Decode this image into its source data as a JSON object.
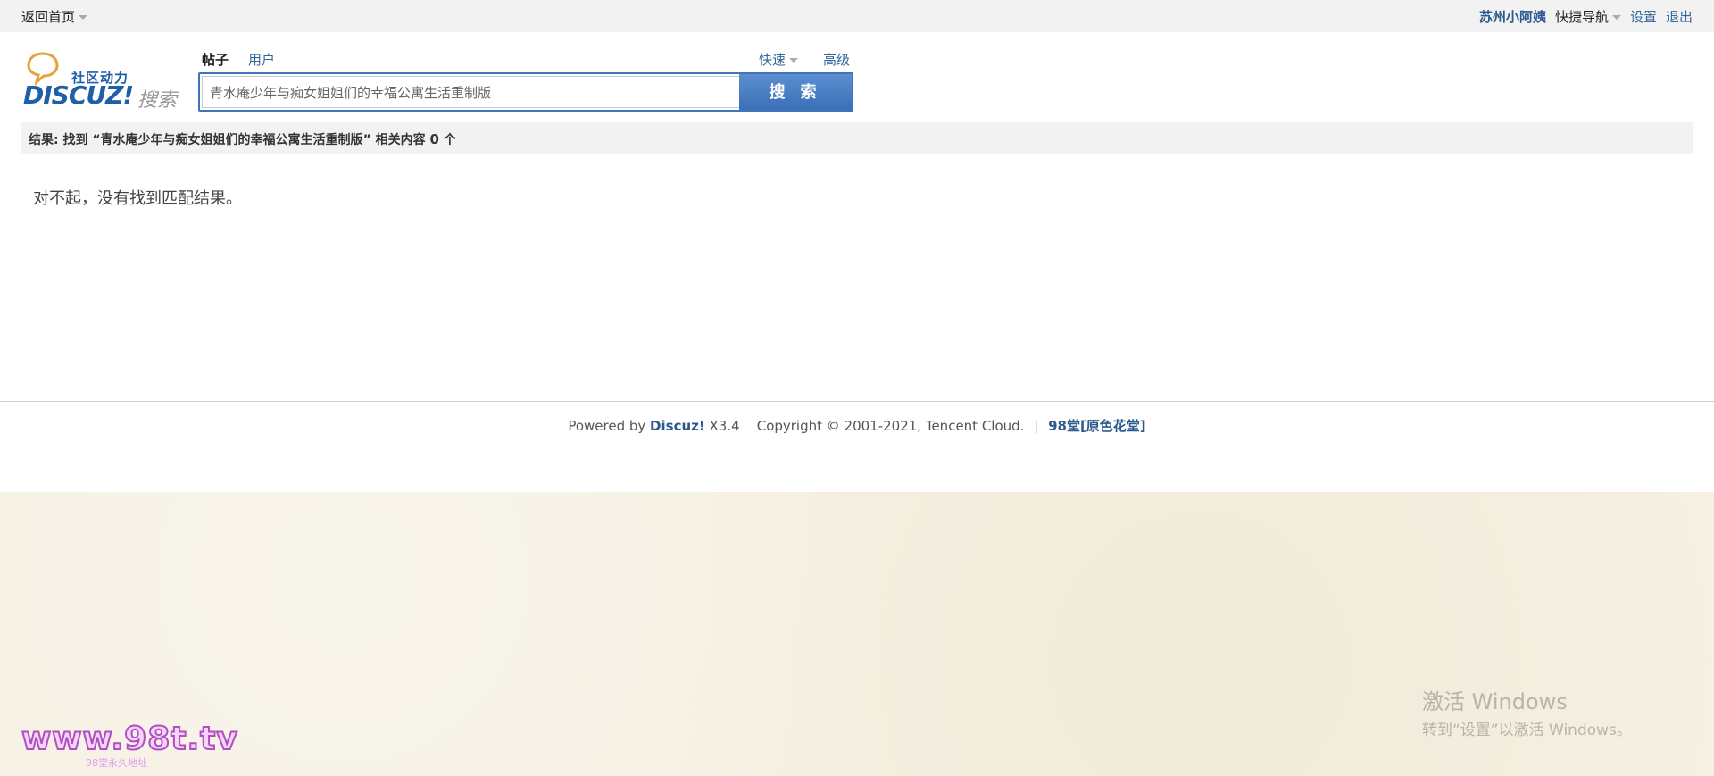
{
  "topbar": {
    "home": "返回首页",
    "user": "苏州小阿姨",
    "quick_nav": "快捷导航",
    "settings": "设置",
    "logout": "退出"
  },
  "logo": {
    "tagline": "社区动力",
    "word": "DISCUZ!",
    "search_word": "搜索"
  },
  "tabs": [
    {
      "label": "帖子",
      "active": true
    },
    {
      "label": "用户",
      "active": false
    }
  ],
  "search_options": {
    "quick": "快速",
    "advanced": "高级"
  },
  "search": {
    "value": "青水庵少年与痴女姐姐们的幸福公寓生活重制版",
    "button": "搜 索"
  },
  "result": {
    "prefix": "结果: 找到 “青水庵少年与痴女姐姐们的幸福公寓生活重制版” 相关内容",
    "count": "0",
    "unit": "个"
  },
  "empty_message": "对不起，没有找到匹配结果。",
  "footer": {
    "powered_by": "Powered by",
    "product": "Discuz!",
    "version": "X3.4",
    "copyright": "Copyright © 2001-2021, Tencent Cloud.",
    "separator": "|",
    "site": "98堂[原色花堂]"
  },
  "watermark": {
    "line1": "激活 Windows",
    "line2": "转到“设置”以激活 Windows。"
  },
  "brand": {
    "url": "www.98t.tv",
    "sub": "98堂永久地址"
  },
  "colors": {
    "link": "#336699",
    "button": "#3f74b9",
    "paper": "#f5f0e2"
  }
}
